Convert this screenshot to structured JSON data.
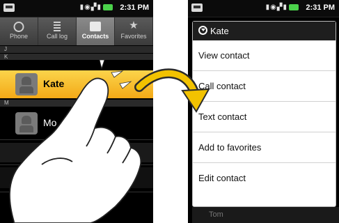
{
  "status_bar": {
    "time": "2:31 PM"
  },
  "tabs": [
    {
      "label": "Phone",
      "icon": "phone-icon"
    },
    {
      "label": "Call log",
      "icon": "call-log-icon"
    },
    {
      "label": "Contacts",
      "icon": "contacts-icon",
      "active": true
    },
    {
      "label": "Favorites",
      "icon": "star-icon"
    }
  ],
  "contact_list": {
    "sections": [
      "J",
      "K",
      "M"
    ],
    "contacts": [
      "Kate",
      "Mo"
    ]
  },
  "context_menu": {
    "title": "Kate",
    "items": [
      "View contact",
      "Call contact",
      "Text contact",
      "Add to favorites",
      "Edit contact"
    ],
    "below_text": "Tom"
  },
  "colors": {
    "highlight": "#f5b224",
    "arrow": "#f2c200",
    "menu_title_bg": "#1e1e1e"
  }
}
